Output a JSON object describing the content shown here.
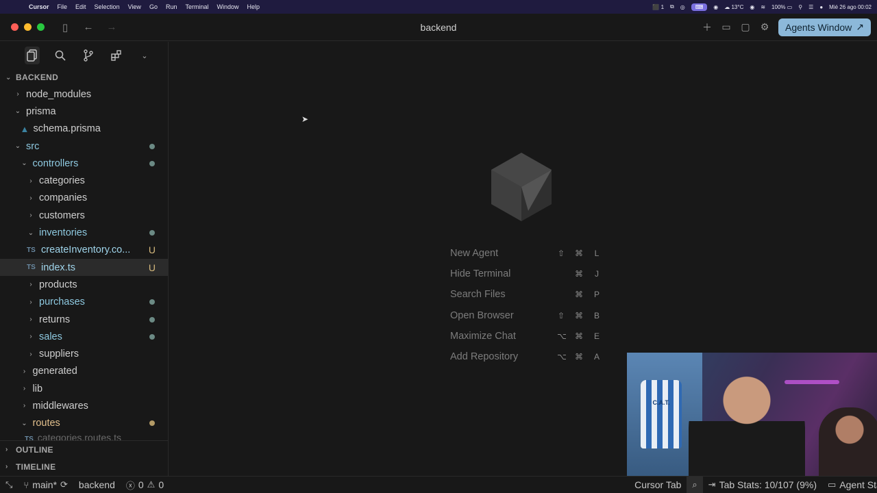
{
  "menubar": {
    "app": "Cursor",
    "items": [
      "File",
      "Edit",
      "Selection",
      "View",
      "Go",
      "Run",
      "Terminal",
      "Window",
      "Help"
    ],
    "tray": {
      "notifications": "1",
      "temperature": "13°C",
      "battery": "100%",
      "datetime": "Mié 26 ago 00:02"
    }
  },
  "titlebar": {
    "title": "backend",
    "agents_button": "Agents Window"
  },
  "sidebar": {
    "explorer_header": "BACKEND",
    "tree": [
      {
        "label": "node_modules",
        "depth": 0,
        "expanded": false
      },
      {
        "label": "prisma",
        "depth": 0,
        "expanded": true
      },
      {
        "label": "schema.prisma",
        "depth": 1,
        "file": "prisma"
      },
      {
        "label": "src",
        "depth": 0,
        "expanded": true,
        "status": "dot",
        "kind": "mod"
      },
      {
        "label": "controllers",
        "depth": 1,
        "expanded": true,
        "status": "dot",
        "kind": "mod"
      },
      {
        "label": "categories",
        "depth": 2,
        "expanded": false
      },
      {
        "label": "companies",
        "depth": 2,
        "expanded": false
      },
      {
        "label": "customers",
        "depth": 2,
        "expanded": false
      },
      {
        "label": "inventories",
        "depth": 2,
        "expanded": true,
        "status": "dot",
        "kind": "mod"
      },
      {
        "label": "createInventory.co...",
        "depth": 2,
        "file": "ts",
        "status": "U",
        "kind": "untracked"
      },
      {
        "label": "index.ts",
        "depth": 2,
        "file": "ts",
        "status": "U",
        "kind": "untracked",
        "selected": true
      },
      {
        "label": "products",
        "depth": 2,
        "expanded": false
      },
      {
        "label": "purchases",
        "depth": 2,
        "expanded": false,
        "status": "dot",
        "kind": "mod"
      },
      {
        "label": "returns",
        "depth": 2,
        "expanded": false,
        "status": "dot"
      },
      {
        "label": "sales",
        "depth": 2,
        "expanded": false,
        "status": "dot",
        "kind": "mod"
      },
      {
        "label": "suppliers",
        "depth": 2,
        "expanded": false
      },
      {
        "label": "generated",
        "depth": 1,
        "expanded": false
      },
      {
        "label": "lib",
        "depth": 1,
        "expanded": false
      },
      {
        "label": "middlewares",
        "depth": 1,
        "expanded": false
      },
      {
        "label": "routes",
        "depth": 1,
        "expanded": true,
        "status": "dot-orange",
        "kind": "orange"
      }
    ],
    "cut_row": "categories.routes.ts",
    "outline_header": "OUTLINE",
    "timeline_header": "TIMELINE"
  },
  "welcome": {
    "shortcuts": [
      {
        "label": "New Agent",
        "keys": [
          "⇧",
          "⌘",
          "L"
        ]
      },
      {
        "label": "Hide Terminal",
        "keys": [
          "⌘",
          "J"
        ]
      },
      {
        "label": "Search Files",
        "keys": [
          "⌘",
          "P"
        ]
      },
      {
        "label": "Open Browser",
        "keys": [
          "⇧",
          "⌘",
          "B"
        ]
      },
      {
        "label": "Maximize Chat",
        "keys": [
          "⌥",
          "⌘",
          "E"
        ]
      },
      {
        "label": "Add Repository",
        "keys": [
          "⌥",
          "⌘",
          "A"
        ]
      }
    ]
  },
  "webcam": {
    "jersey_text": "C.A.T."
  },
  "statusbar": {
    "branch": "main*",
    "workspace": "backend",
    "errors": "0",
    "warnings": "0",
    "cursor_tab": "Cursor Tab",
    "tab_stats": "Tab Stats: 10/107 (9%)",
    "agent": "Agent Sta"
  },
  "icons": {
    "explorer": "files-icon",
    "search": "search-icon",
    "source_control": "git-branch-icon",
    "extensions": "extensions-icon"
  }
}
